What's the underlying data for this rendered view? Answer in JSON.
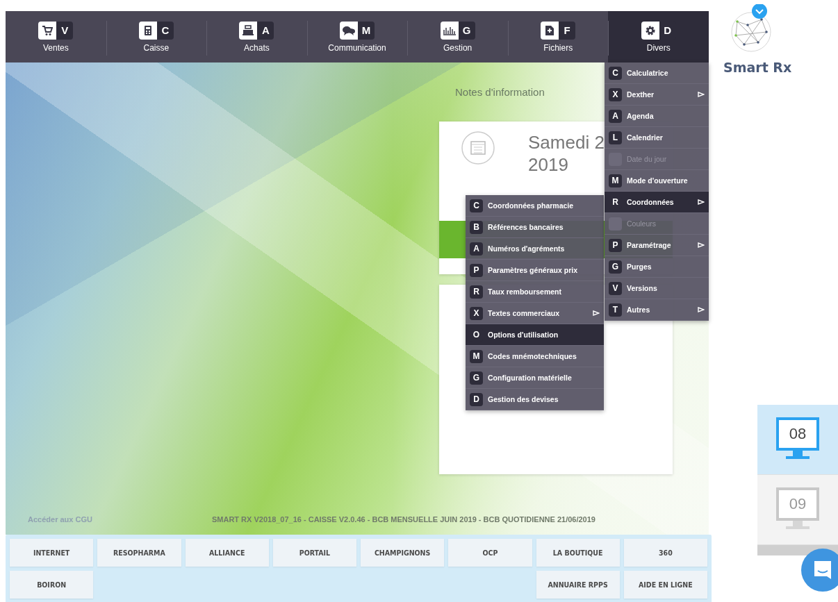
{
  "nav": [
    {
      "letter": "V",
      "label": "Ventes",
      "selected": false
    },
    {
      "letter": "C",
      "label": "Caisse",
      "selected": false
    },
    {
      "letter": "A",
      "label": "Achats",
      "selected": false
    },
    {
      "letter": "M",
      "label": "Communication",
      "selected": false
    },
    {
      "letter": "G",
      "label": "Gestion",
      "selected": false
    },
    {
      "letter": "F",
      "label": "Fichiers",
      "selected": false
    },
    {
      "letter": "D",
      "label": "Divers",
      "selected": true
    }
  ],
  "logo": {
    "name": "Smart Rx"
  },
  "notes": {
    "title": "Notes d'information",
    "date_line_1": "Samedi 2",
    "date_line_2": "2019"
  },
  "divers_menu": [
    {
      "key": "C",
      "label": "Calculatrice",
      "submenu": false,
      "disabled": false,
      "selected": false
    },
    {
      "key": "X",
      "label": "Dexther",
      "submenu": true,
      "disabled": false,
      "selected": false
    },
    {
      "key": "A",
      "label": "Agenda",
      "submenu": false,
      "disabled": false,
      "selected": false
    },
    {
      "key": "L",
      "label": "Calendrier",
      "submenu": false,
      "disabled": false,
      "selected": false
    },
    {
      "label": "Date du jour",
      "submenu": false,
      "disabled": true,
      "selected": false
    },
    {
      "key": "M",
      "label": "Mode d'ouverture",
      "submenu": false,
      "disabled": false,
      "selected": false
    },
    {
      "key": "R",
      "label": "Coordonnées",
      "submenu": true,
      "disabled": false,
      "selected": true
    },
    {
      "label": "Couleurs",
      "submenu": false,
      "disabled": true,
      "selected": false
    },
    {
      "key": "P",
      "label": "Paramétrage",
      "submenu": true,
      "disabled": false,
      "selected": false
    },
    {
      "key": "G",
      "label": "Purges",
      "submenu": false,
      "disabled": false,
      "selected": false
    },
    {
      "key": "V",
      "label": "Versions",
      "submenu": false,
      "disabled": false,
      "selected": false
    },
    {
      "key": "T",
      "label": "Autres",
      "submenu": true,
      "disabled": false,
      "selected": false
    }
  ],
  "coordonnees_submenu": [
    {
      "key": "C",
      "label": "Coordonnées pharmacie",
      "submenu": false,
      "disabled": false,
      "selected": false
    },
    {
      "key": "B",
      "label": "Références bancaires",
      "submenu": false,
      "disabled": false,
      "selected": false
    },
    {
      "key": "A",
      "label": "Numéros d'agréments",
      "submenu": false,
      "disabled": false,
      "selected": false
    },
    {
      "key": "P",
      "label": "Paramètres généraux prix",
      "submenu": false,
      "disabled": false,
      "selected": false
    },
    {
      "key": "R",
      "label": "Taux remboursement",
      "submenu": false,
      "disabled": false,
      "selected": false
    },
    {
      "key": "X",
      "label": "Textes commerciaux",
      "submenu": true,
      "disabled": false,
      "selected": false
    },
    {
      "key": "O",
      "label": "Options d'utilisation",
      "submenu": false,
      "disabled": false,
      "selected": true
    },
    {
      "key": "M",
      "label": "Codes mnémotechniques",
      "submenu": false,
      "disabled": false,
      "selected": false
    },
    {
      "key": "G",
      "label": "Configuration matérielle",
      "submenu": false,
      "disabled": false,
      "selected": false
    },
    {
      "key": "D",
      "label": "Gestion des devises",
      "submenu": false,
      "disabled": false,
      "selected": false
    }
  ],
  "footer": {
    "cgu_link": "Accéder aux CGU",
    "version": "SMART RX V2018_07_16 - CAISSE V2.0.46 - BCB MENSUELLE JUIN 2019 - BCB QUOTIDIENNE 21/06/2019"
  },
  "links": {
    "row_1": [
      "INTERNET",
      "RESOPHARMA",
      "ALLIANCE",
      "PORTAIL",
      "CHAMPIGNONS",
      "OCP",
      "LA BOUTIQUE",
      "360"
    ],
    "row_2_left": [
      "BOIRON"
    ],
    "row_2_right": [
      "ANNUAIRE RPPS",
      "AIDE EN LIGNE"
    ]
  },
  "workstations": [
    {
      "number": "08",
      "selected": true
    },
    {
      "number": "09",
      "selected": false
    }
  ]
}
